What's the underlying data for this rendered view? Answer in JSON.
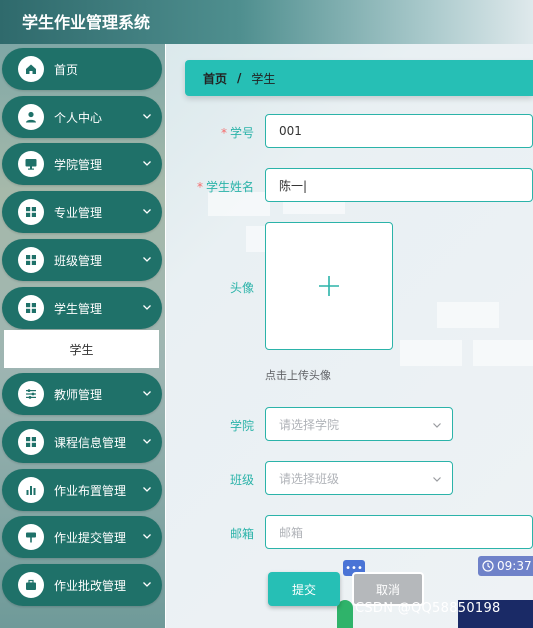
{
  "app": {
    "title": "学生作业管理系统"
  },
  "sidebar": {
    "items": [
      {
        "label": "首页",
        "icon": "home-icon",
        "expandable": false
      },
      {
        "label": "个人中心",
        "icon": "user-icon",
        "expandable": true
      },
      {
        "label": "学院管理",
        "icon": "monitor-icon",
        "expandable": true
      },
      {
        "label": "专业管理",
        "icon": "grid-icon",
        "expandable": true
      },
      {
        "label": "班级管理",
        "icon": "grid-icon",
        "expandable": true
      },
      {
        "label": "学生管理",
        "icon": "grid-icon",
        "expandable": true
      },
      {
        "label": "教师管理",
        "icon": "sliders-icon",
        "expandable": true
      },
      {
        "label": "课程信息管理",
        "icon": "grid-icon",
        "expandable": true
      },
      {
        "label": "作业布置管理",
        "icon": "bar-chart-icon",
        "expandable": true
      },
      {
        "label": "作业提交管理",
        "icon": "signpost-icon",
        "expandable": true
      },
      {
        "label": "作业批改管理",
        "icon": "briefcase-icon",
        "expandable": true
      }
    ],
    "submenu": {
      "label": "学生"
    }
  },
  "breadcrumb": {
    "home": "首页",
    "separator": "/",
    "current": "学生"
  },
  "form": {
    "student_id": {
      "label": "学号",
      "required": "*",
      "value": "001"
    },
    "student_name": {
      "label": "学生姓名",
      "required": "*",
      "value": "陈一|"
    },
    "avatar": {
      "label": "头像",
      "hint": "点击上传头像"
    },
    "college": {
      "label": "学院",
      "placeholder": "请选择学院"
    },
    "class": {
      "label": "班级",
      "placeholder": "请选择班级"
    },
    "email": {
      "label": "邮箱",
      "placeholder": "邮箱"
    },
    "submit_label": "提交",
    "cancel_label": "取消"
  },
  "overlay": {
    "clock": "09:37",
    "more": "•••",
    "watermark": "CSDN @QQ58850198"
  },
  "colors": {
    "accent": "#26bfb5",
    "sidebar_item": "#1f7169",
    "required": "#f56c6c"
  }
}
